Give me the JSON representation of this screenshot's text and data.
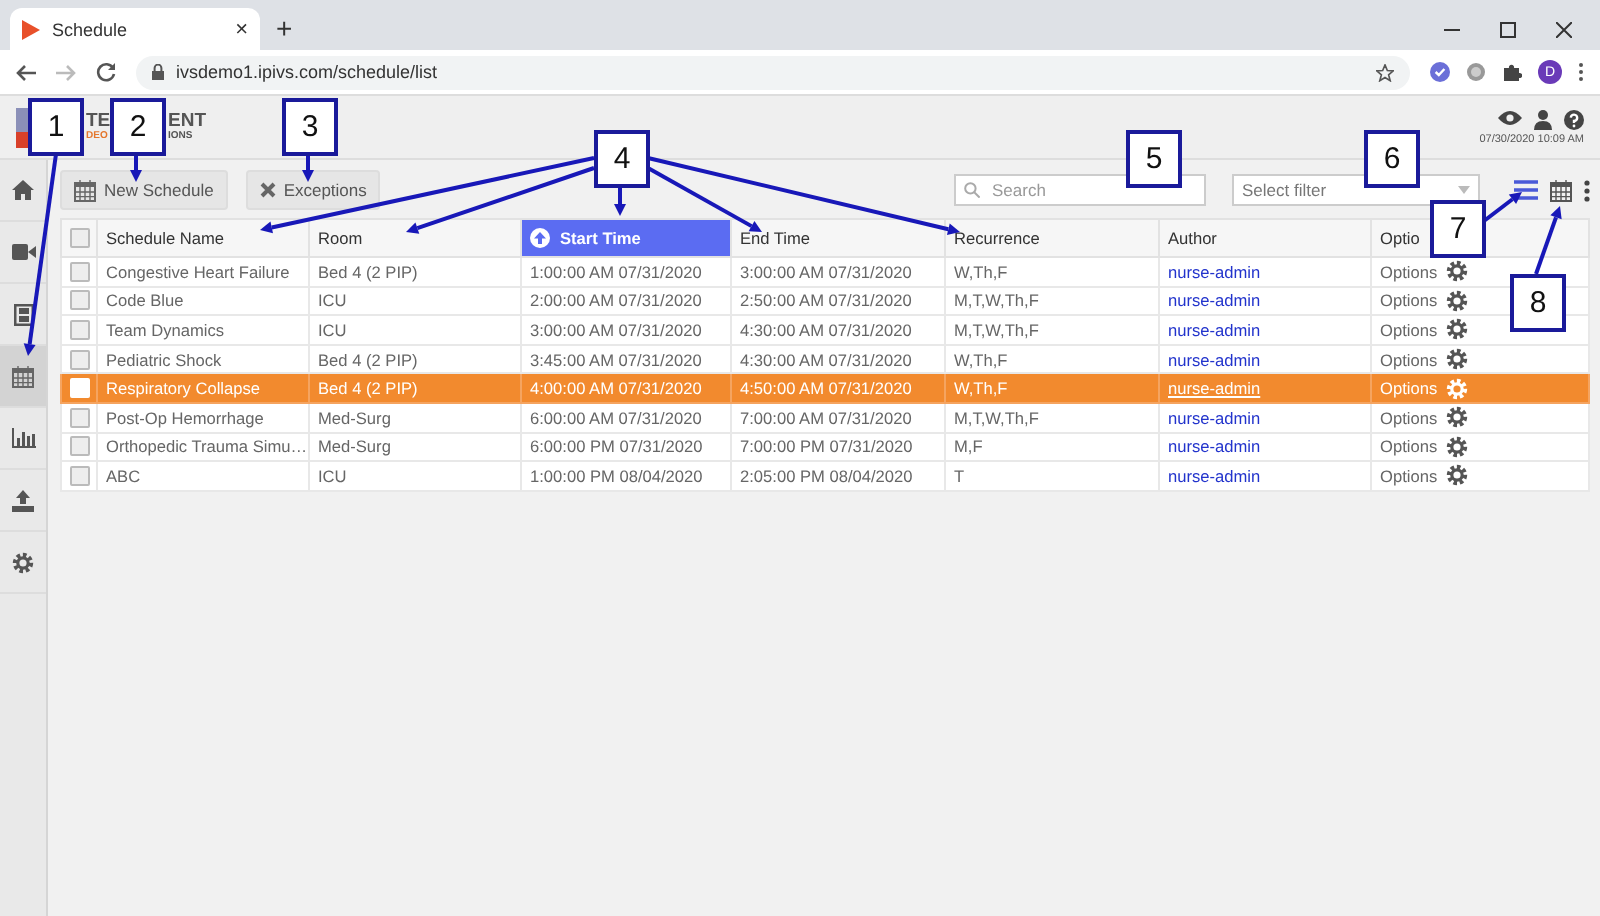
{
  "browser": {
    "tab": {
      "title": "Schedule",
      "close": "×"
    },
    "new_tab": "+",
    "url": "ivsdemo1.ipivs.com/schedule/list",
    "profile_initial": "D"
  },
  "header": {
    "logo_line1": [
      "TE",
      "ENT"
    ],
    "logo_line2": [
      "DEO",
      "IONS"
    ],
    "datetime": "07/30/2020 10:09 AM"
  },
  "sidebar": {
    "items": [
      {
        "kind": "home",
        "selected": false
      },
      {
        "kind": "video",
        "selected": false
      },
      {
        "kind": "film",
        "selected": false
      },
      {
        "kind": "calendar",
        "selected": true
      },
      {
        "kind": "chart",
        "selected": false
      },
      {
        "kind": "upload",
        "selected": false
      },
      {
        "kind": "settings",
        "selected": false
      }
    ]
  },
  "toolbar": {
    "buttons": [
      {
        "kind": "calendar",
        "label": "New Schedule"
      },
      {
        "kind": "close",
        "label": "Exceptions"
      }
    ],
    "search": {
      "placeholder": "Search"
    },
    "filter": {
      "placeholder": "Select filter"
    },
    "view_toggle": [
      {
        "kind": "list",
        "selected": true
      },
      {
        "kind": "calendar",
        "selected": false
      }
    ]
  },
  "table": {
    "select_all_checked": false,
    "columns": [
      {
        "label": "Schedule Name",
        "sorted": false
      },
      {
        "label": "Room",
        "sorted": false
      },
      {
        "label": "Start Time",
        "sorted": true
      },
      {
        "label": "End Time",
        "sorted": false
      },
      {
        "label": "Recurrence",
        "sorted": false
      },
      {
        "label": "Author",
        "sorted": false
      },
      {
        "label": "Optio",
        "sorted": false
      }
    ],
    "rows": [
      {
        "name": "Congestive Heart Failure",
        "room": "Bed 4 (2 PIP)",
        "start": "1:00:00 AM 07/31/2020",
        "end": "3:00:00 AM 07/31/2020",
        "recurrence": "W,Th,F",
        "author": "nurse-admin",
        "options": "Options",
        "selected": false,
        "checked": false
      },
      {
        "name": "Code Blue",
        "room": "ICU",
        "start": "2:00:00 AM 07/31/2020",
        "end": "2:50:00 AM 07/31/2020",
        "recurrence": "M,T,W,Th,F",
        "author": "nurse-admin",
        "options": "Options",
        "selected": false,
        "checked": false
      },
      {
        "name": "Team Dynamics",
        "room": "ICU",
        "start": "3:00:00 AM 07/31/2020",
        "end": "4:30:00 AM 07/31/2020",
        "recurrence": "M,T,W,Th,F",
        "author": "nurse-admin",
        "options": "Options",
        "selected": false,
        "checked": false
      },
      {
        "name": "Pediatric Shock",
        "room": "Bed 4 (2 PIP)",
        "start": "3:45:00 AM 07/31/2020",
        "end": "4:30:00 AM 07/31/2020",
        "recurrence": "W,Th,F",
        "author": "nurse-admin",
        "options": "Options",
        "selected": false,
        "checked": false
      },
      {
        "name": "Respiratory Collapse",
        "room": "Bed 4 (2 PIP)",
        "start": "4:00:00 AM 07/31/2020",
        "end": "4:50:00 AM 07/31/2020",
        "recurrence": "W,Th,F",
        "author": "nurse-admin",
        "options": "Options",
        "selected": true,
        "checked": false
      },
      {
        "name": "Post-Op Hemorrhage",
        "room": "Med-Surg",
        "start": "6:00:00 AM 07/31/2020",
        "end": "7:00:00 AM 07/31/2020",
        "recurrence": "M,T,W,Th,F",
        "author": "nurse-admin",
        "options": "Options",
        "selected": false,
        "checked": false
      },
      {
        "name": "Orthopedic Trauma Simu…",
        "room": "Med-Surg",
        "start": "6:00:00 PM 07/31/2020",
        "end": "7:00:00 PM 07/31/2020",
        "recurrence": "M,F",
        "author": "nurse-admin",
        "options": "Options",
        "selected": false,
        "checked": false
      },
      {
        "name": "ABC",
        "room": "ICU",
        "start": "1:00:00 PM 08/04/2020",
        "end": "2:05:00 PM 08/04/2020",
        "recurrence": "T",
        "author": "nurse-admin",
        "options": "Options",
        "selected": false,
        "checked": false
      }
    ]
  },
  "annotations": [
    {
      "label": "1"
    },
    {
      "label": "2"
    },
    {
      "label": "3"
    },
    {
      "label": "4"
    },
    {
      "label": "5"
    },
    {
      "label": "6"
    },
    {
      "label": "7"
    },
    {
      "label": "8"
    }
  ]
}
